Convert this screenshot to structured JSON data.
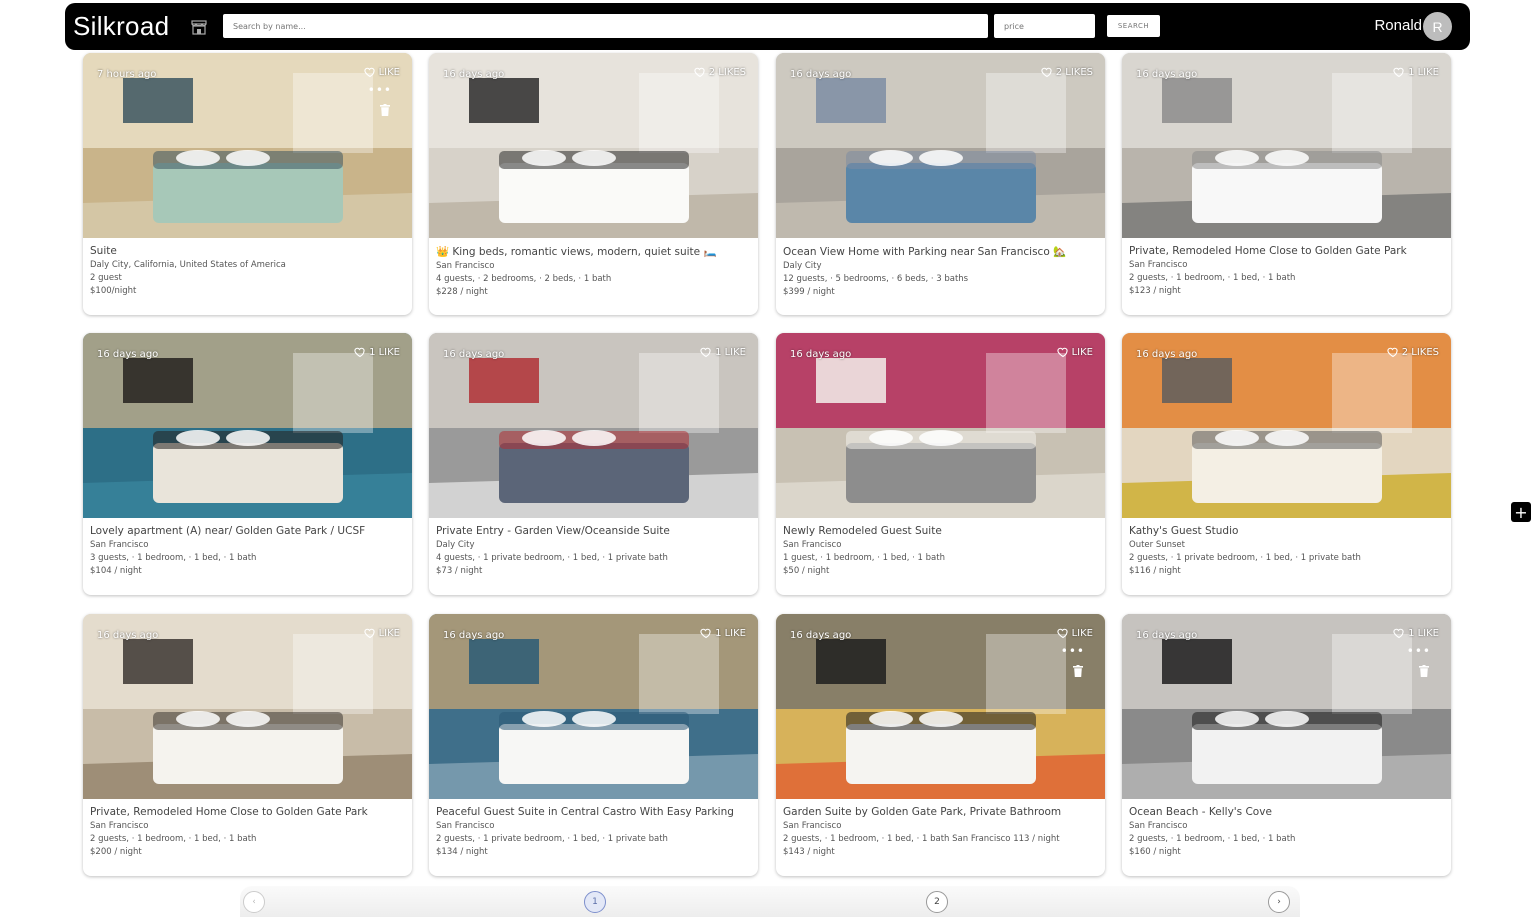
{
  "header": {
    "brand": "Silkroad",
    "search_placeholder": "Search by name...",
    "price_placeholder": "price",
    "search_label": "SEARCH",
    "user_name": "Ronald",
    "avatar_initial": "R"
  },
  "listings": [
    {
      "time": "7 hours ago",
      "likes": "LIKE",
      "title": "Suite",
      "location": "Daly City, California, United States of America",
      "details": "2 guest",
      "price": "$100/night",
      "owner": true
    },
    {
      "time": "16 days ago",
      "likes": "2 LIKES",
      "title": "👑 King beds, romantic views, modern, quiet suite 🛏️",
      "location": "San Francisco",
      "details": "4 guests, · 2 bedrooms, · 2 beds, · 1 bath",
      "price": "$228 / night",
      "owner": false
    },
    {
      "time": "16 days ago",
      "likes": "2 LIKES",
      "title": "Ocean View Home with Parking near San Francisco 🏡",
      "location": "Daly City",
      "details": "12 guests, · 5 bedrooms, · 6 beds, · 3 baths",
      "price": "$399 / night",
      "owner": false
    },
    {
      "time": "16 days ago",
      "likes": "1 LIKE",
      "title": "Private, Remodeled Home Close to Golden Gate Park",
      "location": "San Francisco",
      "details": "2 guests, · 1 bedroom, · 1 bed, · 1 bath",
      "price": "$123 / night",
      "owner": false
    },
    {
      "time": "16 days ago",
      "likes": "1 LIKE",
      "title": "Lovely apartment (A) near/ Golden Gate Park / UCSF",
      "location": "San Francisco",
      "details": "3 guests, · 1 bedroom, · 1 bed, · 1 bath",
      "price": "$104 / night",
      "owner": false
    },
    {
      "time": "16 days ago",
      "likes": "1 LIKE",
      "title": "Private Entry - Garden View/Oceanside Suite",
      "location": "Daly City",
      "details": "4 guests, · 1 private bedroom, · 1 bed, · 1 private bath",
      "price": "$73 / night",
      "owner": false
    },
    {
      "time": "16 days ago",
      "likes": "LIKE",
      "title": "Newly Remodeled Guest Suite",
      "location": "San Francisco",
      "details": "1 guest, · 1 bedroom, · 1 bed, · 1 bath",
      "price": "$50 / night",
      "owner": false
    },
    {
      "time": "16 days ago",
      "likes": "2 LIKES",
      "title": "Kathy's Guest Studio",
      "location": "Outer Sunset",
      "details": "2 guests, · 1 private bedroom, · 1 bed, · 1 private bath",
      "price": "$116 / night",
      "owner": false
    },
    {
      "time": "16 days ago",
      "likes": "LIKE",
      "title": "Private, Remodeled Home Close to Golden Gate Park",
      "location": "San Francisco",
      "details": "2 guests, · 1 bedroom, · 1 bed, · 1 bath",
      "price": "$200 / night",
      "owner": false
    },
    {
      "time": "16 days ago",
      "likes": "1 LIKE",
      "title": "Peaceful Guest Suite in Central Castro With Easy Parking",
      "location": "San Francisco",
      "details": "2 guests, · 1 private bedroom, · 1 bed, · 1 private bath",
      "price": "$134 / night",
      "owner": false
    },
    {
      "time": "16 days ago",
      "likes": "LIKE",
      "title": "Garden Suite by Golden Gate Park, Private Bathroom",
      "location": "San Francisco",
      "details": "2 guests, · 1 bedroom, · 1 bed, · 1 bath San Francisco 113 / night",
      "price": "$143 / night",
      "owner": true
    },
    {
      "time": "16 days ago",
      "likes": "1 LIKE",
      "title": "Ocean Beach - Kelly's Cove",
      "location": "San Francisco",
      "details": "2 guests, · 1 bedroom, · 1 bed, · 1 bath",
      "price": "$160 / night",
      "owner": true
    }
  ],
  "more_glyph": "•••",
  "fab_label": "+",
  "pagination": {
    "prev": "‹",
    "pages": [
      "1",
      "2"
    ],
    "next": "›"
  }
}
